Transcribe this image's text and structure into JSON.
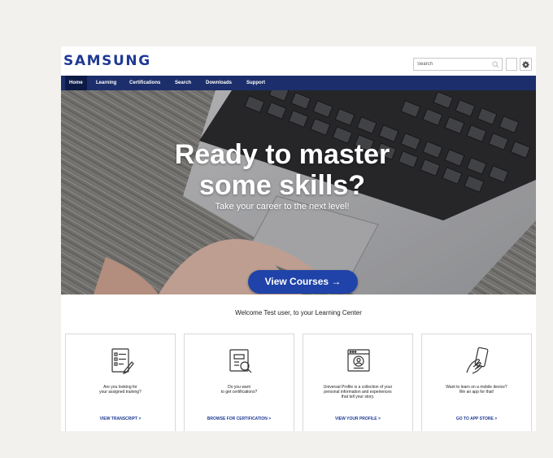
{
  "brand": {
    "logo": "SAMSUNG",
    "color": "#1f3a93"
  },
  "search": {
    "placeholder": "Search"
  },
  "nav": {
    "items": [
      {
        "label": "Home",
        "active": true
      },
      {
        "label": "Learning"
      },
      {
        "label": "Certifications"
      },
      {
        "label": "Search"
      },
      {
        "label": "Downloads"
      },
      {
        "label": "Support"
      }
    ]
  },
  "hero": {
    "title_line1": "Ready to master",
    "title_line2": "some skills?",
    "subtitle": "Take your career to the next level!",
    "cta": "View Courses →"
  },
  "welcome": "Welcome Test user, to your Learning Center",
  "cards": [
    {
      "icon": "checklist-icon",
      "line1": "Are you looking for",
      "line2": "your assigned training?",
      "link": "VIEW TRANSCRIPT >"
    },
    {
      "icon": "certificate-search-icon",
      "line1": "Do you want",
      "line2": "to get certifications?",
      "link": "BROWSE FOR CERTIFICATION >"
    },
    {
      "icon": "profile-window-icon",
      "line1": "Universal Profile is a collection of your",
      "line2": "personal information and experiences",
      "line3": "that tell your story.",
      "link": "VIEW YOUR PROFILE >"
    },
    {
      "icon": "mobile-device-icon",
      "line1": "Want to learn on a mobile device?",
      "line2": "We an app for that!",
      "link": "GO TO APP STORE >"
    }
  ]
}
